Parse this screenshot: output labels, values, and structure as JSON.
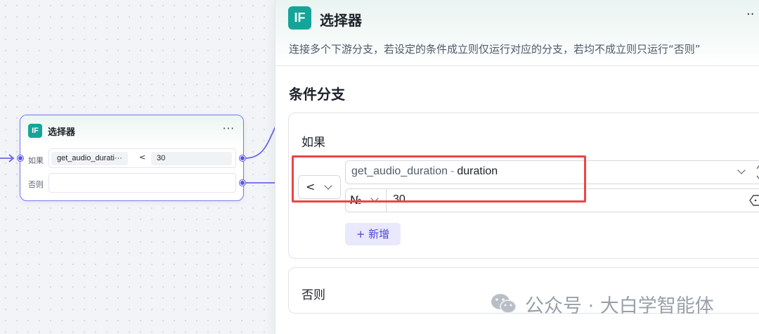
{
  "canvas": {
    "node": {
      "badge": "IF",
      "title": "选择器",
      "menu": "···",
      "if_label": "如果",
      "else_label": "否则",
      "condition": {
        "variable": "get_audio_durati···",
        "operator": "<",
        "value": "30"
      }
    }
  },
  "panel": {
    "badge": "IF",
    "title": "选择器",
    "menu": "··",
    "description": "连接多个下游分支，若设定的条件成立则仅运行对应的分支，若均不成立则只运行“否则”",
    "section_title": "条件分支",
    "if_card": {
      "label": "如果",
      "operator": "<",
      "variable_name": "get_audio_duration",
      "separator": "-",
      "variable_field": "duration",
      "value_type": "№",
      "value": "30",
      "add_label": "+ 新增"
    },
    "else_card": {
      "label": "否则"
    }
  },
  "watermark": {
    "text": "公众号 · 大白学智能体"
  },
  "colors": {
    "accent": "#5b55e6",
    "if_badge": "#14a59a",
    "highlight": "#ef4444",
    "add_button_bg": "#e9e8fc"
  },
  "icons": [
    "chevron-down-icon",
    "plus-icon",
    "wechat-icon",
    "more-icon"
  ]
}
